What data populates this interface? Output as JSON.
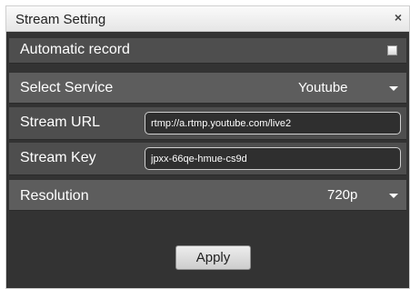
{
  "dialog": {
    "title": "Stream Setting",
    "close_label": "×"
  },
  "rows": {
    "automatic_record": {
      "label": "Automatic record",
      "checked": false
    },
    "select_service": {
      "label": "Select Service",
      "value": "Youtube"
    },
    "stream_url": {
      "label": "Stream URL",
      "value": "rtmp://a.rtmp.youtube.com/live2"
    },
    "stream_key": {
      "label": "Stream Key",
      "value": "jpxx-66qe-hmue-cs9d"
    },
    "resolution": {
      "label": "Resolution",
      "value": "720p"
    }
  },
  "apply_label": "Apply",
  "colors": {
    "panel_bg": "#333333",
    "row_dark": "#4e4e4e",
    "row_mid": "#5d5d5d",
    "text": "#ffffff"
  }
}
